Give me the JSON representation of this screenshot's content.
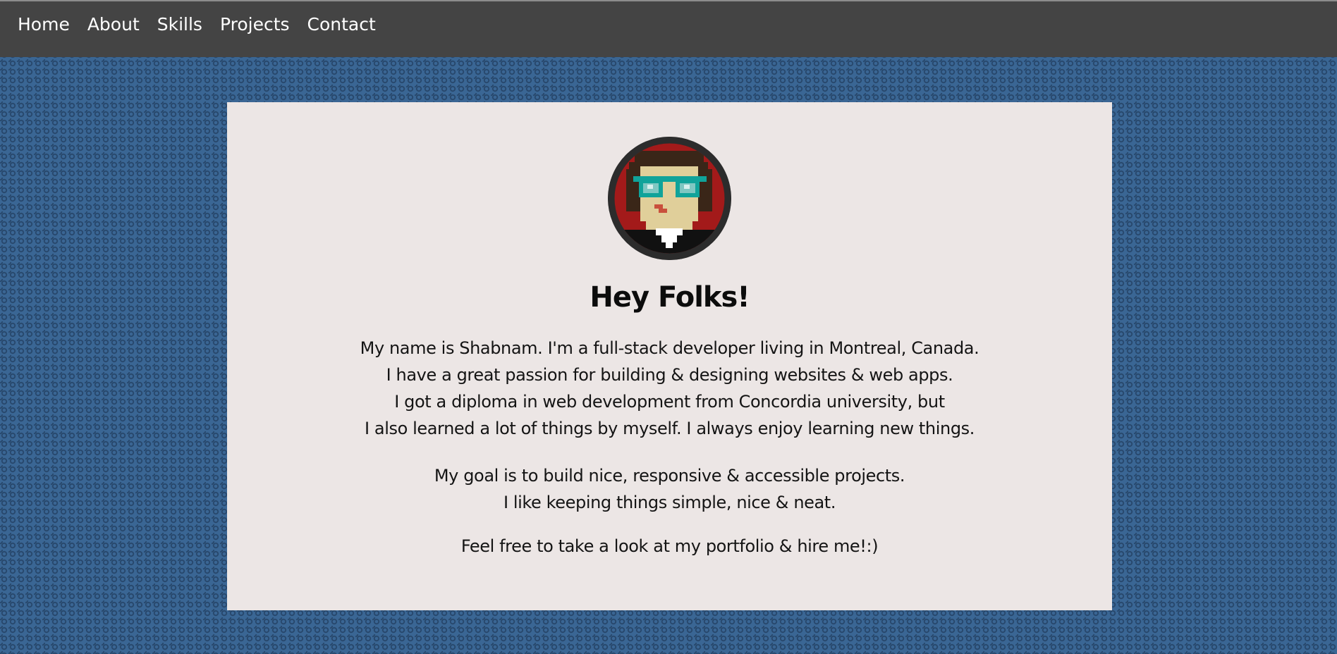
{
  "nav": {
    "items": [
      {
        "label": "Home"
      },
      {
        "label": "About"
      },
      {
        "label": "Skills"
      },
      {
        "label": "Projects"
      },
      {
        "label": "Contact"
      }
    ]
  },
  "about": {
    "avatar_icon": "pixel-art-avatar-icon",
    "heading": "Hey Folks!",
    "intro_lines": [
      "My name is Shabnam. I'm a full-stack developer living in Montreal, Canada.",
      "I have a great passion for building & designing websites & web apps.",
      "I got a diploma in web development from Concordia university, but",
      "I also learned a lot of things by myself. I always enjoy learning new things."
    ],
    "goal_lines": [
      "My goal is to build nice, responsive & accessible projects.",
      "I like keeping things simple, nice & neat."
    ],
    "closing": "Feel free to take a look at my portfolio & hire me!:)"
  },
  "colors": {
    "navbar": "#444444",
    "background": "#3a6694",
    "card": "#ece6e5",
    "text": "#141414"
  }
}
